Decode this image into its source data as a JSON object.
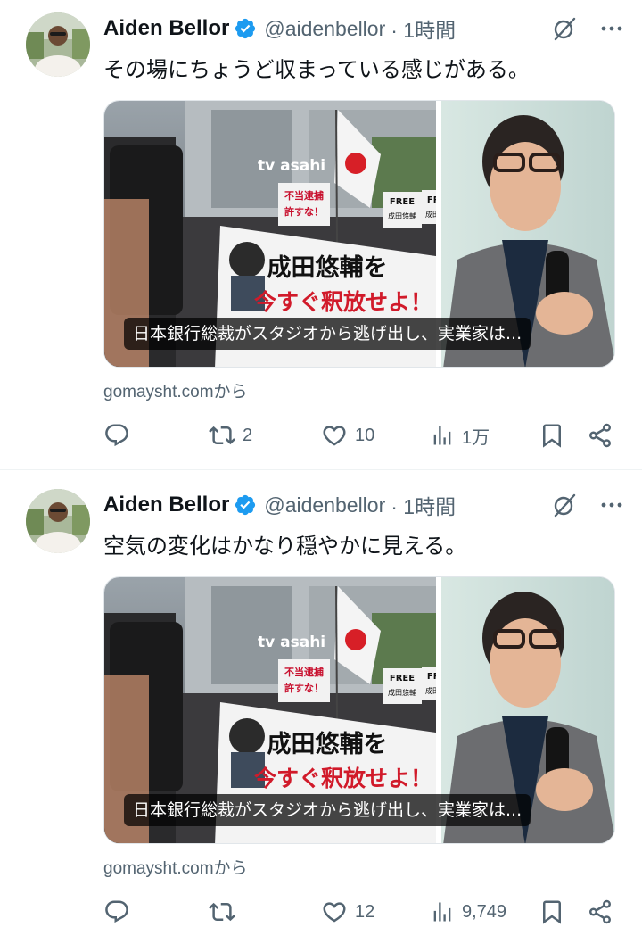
{
  "tweets": [
    {
      "author_name": "Aiden Bellor",
      "handle": "@aidenbellor",
      "time": "· 1時間",
      "text": "その場にちょうど収まっている感じがある。",
      "media_caption": "日本銀行総裁がスタジオから逃げ出し、実業家は...",
      "source": "gomaysht.comから",
      "replies": "",
      "reposts": "2",
      "likes": "10",
      "views": "1万"
    },
    {
      "author_name": "Aiden Bellor",
      "handle": "@aidenbellor",
      "time": "· 1時間",
      "text": "空気の変化はかなり穏やかに見える。",
      "media_caption": "日本銀行総裁がスタジオから逃げ出し、実業家は...",
      "source": "gomaysht.comから",
      "replies": "",
      "reposts": "",
      "likes": "12",
      "views": "9,749"
    }
  ],
  "image_text": {
    "channel": "tv asahi",
    "sign_left": "不当逮捕 許すな！",
    "sign_free": "FREE",
    "sign_name": "成田悠輔",
    "banner_line1": "成田悠輔を",
    "banner_line2": "今すぐ釈放せよ！",
    "banner_small": "FREE NOW!"
  },
  "colors": {
    "verified_blue": "#1d9bf0",
    "secondary_text": "#536471",
    "primary_text": "#0f1419",
    "divider": "#eff3f4"
  },
  "icons": [
    "verified-badge-icon",
    "grok-icon",
    "more-icon",
    "reply-icon",
    "repost-icon",
    "like-icon",
    "views-icon",
    "bookmark-icon",
    "share-icon"
  ]
}
